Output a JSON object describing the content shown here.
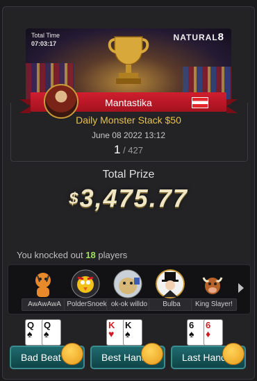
{
  "banner": {
    "total_time_label": "Total Time",
    "total_time_value": "07:03:17",
    "brand": "NATURAL",
    "brand_suffix": "8"
  },
  "player": {
    "name": "Mantastika",
    "flag": "austria-flag"
  },
  "tournament": {
    "name": "Daily Monster Stack $50",
    "date": "June 08 2022 13:12",
    "position": "1",
    "total": "/ 427"
  },
  "prize": {
    "label": "Total Prize",
    "currency": "$",
    "amount": "3,475.77"
  },
  "knockouts": {
    "prefix": "You knocked out",
    "count": "18",
    "suffix": "players",
    "players": [
      {
        "name": "AwAwAwA",
        "avatar": "tiger-avatar"
      },
      {
        "name": "PolderSnoek",
        "avatar": "bird-avatar"
      },
      {
        "name": "ok-ok willdo",
        "avatar": "dog-avatar"
      },
      {
        "name": "Bulba",
        "avatar": "gentleman-avatar"
      },
      {
        "name": "King Slayer!",
        "avatar": "bull-avatar"
      }
    ]
  },
  "actions": [
    {
      "label": "Bad Beat",
      "cards": [
        {
          "rank": "Q",
          "suit": "♠"
        },
        {
          "rank": "Q",
          "suit": "♠"
        }
      ]
    },
    {
      "label": "Best Hand",
      "cards": [
        {
          "rank": "K",
          "suit": "♥"
        },
        {
          "rank": "K",
          "suit": "♠"
        }
      ]
    },
    {
      "label": "Last Hand",
      "cards": [
        {
          "rank": "6",
          "suit": "♠"
        },
        {
          "rank": "6",
          "suit": "♦"
        }
      ]
    }
  ],
  "colors": {
    "accent_gold": "#e8c14a",
    "ribbon_red": "#d01e2e",
    "button_teal": "#1f6a6e",
    "count_green": "#9ee05a"
  }
}
